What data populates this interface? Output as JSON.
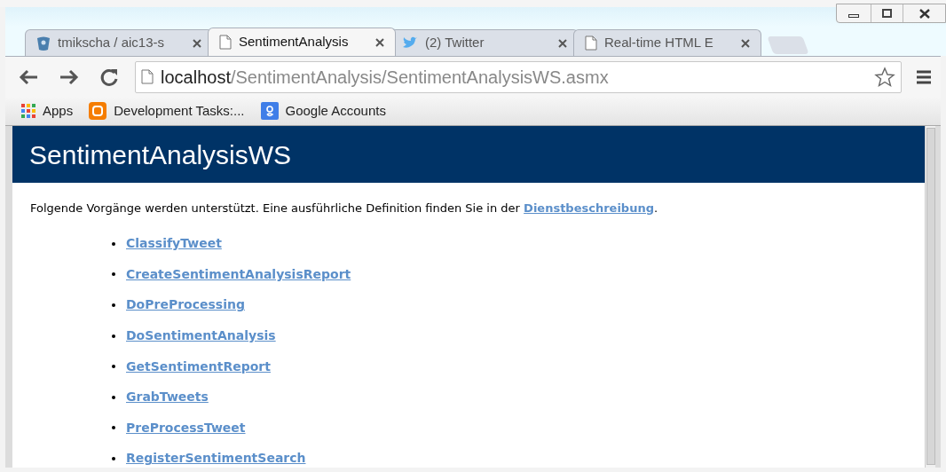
{
  "tabs": [
    {
      "kind": "repo",
      "label": "tmikscha / aic13-s",
      "selected": false
    },
    {
      "kind": "page",
      "label": "SentimentAnalysis",
      "selected": true
    },
    {
      "kind": "bird",
      "label": "(2) Twitter",
      "selected": false
    },
    {
      "kind": "page",
      "label": "Real-time HTML E",
      "selected": false
    }
  ],
  "address": {
    "host": "localhost",
    "path": "/SentimentAnalysis/SentimentAnalysisWS.asmx"
  },
  "bookmarks": [
    {
      "kind": "apps",
      "label": "Apps"
    },
    {
      "kind": "blog",
      "label": "Development Tasks:..."
    },
    {
      "kind": "google",
      "label": "Google Accounts"
    }
  ],
  "page": {
    "title": "SentimentAnalysisWS",
    "intro": "Folgende Vorgänge werden unterstützt. Eine ausführliche Definition finden Sie in der",
    "intro_link": "Dienstbeschreibung",
    "intro_end": ".",
    "operations": [
      "ClassifyTweet",
      "CreateSentimentAnalysisReport",
      "DoPreProcessing",
      "DoSentimentAnalysis",
      "GetSentimentReport",
      "GrabTweets",
      "PreProcessTweet",
      "RegisterSentimentSearch"
    ]
  }
}
